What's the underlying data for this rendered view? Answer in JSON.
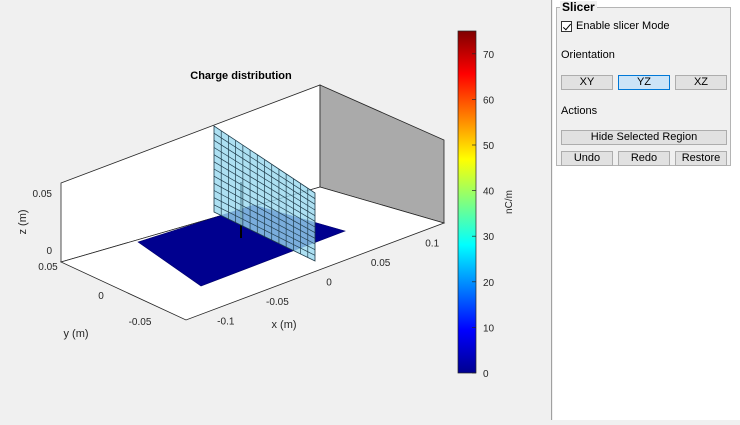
{
  "chart_data": {
    "type": "surface3d",
    "title": "Charge distribution",
    "xlabel": "x (m)",
    "ylabel": "y (m)",
    "zlabel": "z (m)",
    "x_ticks": [
      "-0.1",
      "-0.05",
      "0",
      "0.05",
      "0.1"
    ],
    "y_ticks": [
      "-0.05",
      "0",
      "0.05"
    ],
    "z_ticks": [
      "0",
      "0.05"
    ],
    "colorbar": {
      "label": "nC/m",
      "min": 0,
      "max": 75,
      "ticks": [
        "0",
        "10",
        "20",
        "30",
        "40",
        "50",
        "60",
        "70"
      ],
      "colormap": "jet"
    },
    "plane_color": "#00008f",
    "slice_color": "#99d8ef",
    "slice_orientation": "YZ"
  },
  "slicer": {
    "title": "Slicer",
    "enable_label": "Enable slicer Mode",
    "enable_checked": true,
    "orientation_label": "Orientation",
    "orientation_buttons": [
      "XY",
      "YZ",
      "XZ"
    ],
    "orientation_selected": "YZ",
    "actions_label": "Actions",
    "hide_label": "Hide Selected Region",
    "undo_label": "Undo",
    "redo_label": "Redo",
    "restore_label": "Restore"
  }
}
